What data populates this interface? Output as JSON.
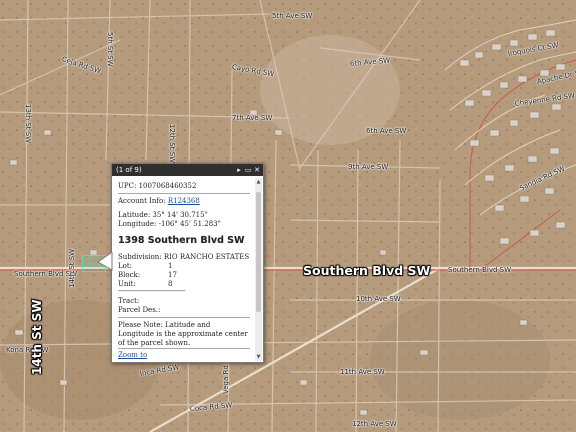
{
  "map": {
    "streets": [
      {
        "id": "5th-ave-sw-top",
        "text": "5th Ave SW"
      },
      {
        "id": "6th-ave-sw-right",
        "text": "6th Ave SW"
      },
      {
        "id": "ceja-rd-sw",
        "text": "Ceja Rd SW"
      },
      {
        "id": "cayo-rd-sw",
        "text": "Cayo Rd SW"
      },
      {
        "id": "6th-ave-sw-mid",
        "text": "6th Ave SW"
      },
      {
        "id": "7th-ave-sw",
        "text": "7th Ave SW"
      },
      {
        "id": "13th-st-sw",
        "text": "13th St SW"
      },
      {
        "id": "12th-st-sw",
        "text": "12th St SW"
      },
      {
        "id": "5th-st-sw",
        "text": "5th St SW"
      },
      {
        "id": "9th-ave-sw",
        "text": "9th Ave SW"
      },
      {
        "id": "apache-dr-sw",
        "text": "Apache Dr SW"
      },
      {
        "id": "cheyenne-rd-sw",
        "text": "Cheyenne Rd SW"
      },
      {
        "id": "iroquois-ct-sw",
        "text": "Iroquois Ct SW"
      },
      {
        "id": "sandia-rd-sw",
        "text": "Sandia Rd SW"
      },
      {
        "id": "southern-blvd-small",
        "text": "Southern Blvd SW"
      },
      {
        "id": "southern-blvd-right",
        "text": "Southern Blvd SW"
      },
      {
        "id": "10th-ave-sw",
        "text": "10th Ave SW"
      },
      {
        "id": "11th-ave-sw",
        "text": "11th Ave SW"
      },
      {
        "id": "12th-ave-sw",
        "text": "12th Ave SW"
      },
      {
        "id": "inca-rd-sw",
        "text": "Inca Rd SW"
      },
      {
        "id": "coca-rd-sw",
        "text": "Coca Rd SW"
      },
      {
        "id": "vega-rd-sw",
        "text": "Vega Rd SW"
      },
      {
        "id": "14th-st-sw-small",
        "text": "14th St SW"
      },
      {
        "id": "kona-rd-sw",
        "text": "Kona Rd SW"
      }
    ],
    "big_labels": {
      "southern_blvd": "Southern Blvd SW",
      "14th_st": "14th St SW"
    }
  },
  "popup": {
    "counter": "(1 of 9)",
    "upc_label": "UPC:",
    "upc_value": "1007068460352",
    "account_label": "Account Info:",
    "account_value": "R124368",
    "latitude": "Latitude: 35° 14' 30.715\"",
    "longitude": "Longitude: -106° 45' 51.283\"",
    "address": "1398 Southern Blvd SW",
    "subdivision": "Subdivision: RIO RANCHO ESTATES",
    "lot_label": "Lot:",
    "lot_value": "1",
    "block_label": "Block:",
    "block_value": "17",
    "unit_label": "Unit:",
    "unit_value": "8",
    "dashes": "------------------------------------",
    "tract_label": "Tract:",
    "parcel_label": "Parcel Des.:",
    "note": "Please Note: Latitude and Longitude is the approximate center of the parcel shown.",
    "zoom_link": "Zoom to"
  }
}
